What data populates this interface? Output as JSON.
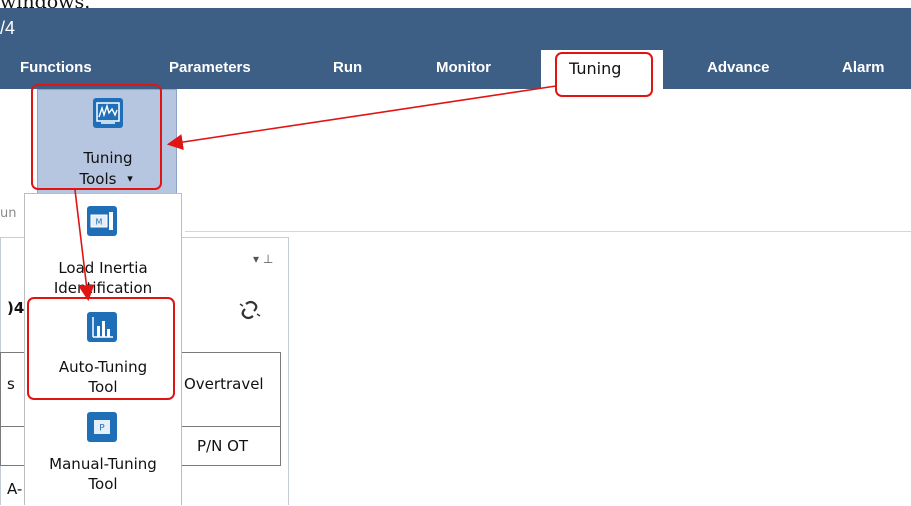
{
  "caption": "windows.",
  "window": {
    "version": "/4"
  },
  "menu": {
    "tabs": [
      {
        "label": "Functions"
      },
      {
        "label": "Parameters"
      },
      {
        "label": "Run"
      },
      {
        "label": "Monitor"
      },
      {
        "label": "Tuning"
      },
      {
        "label": "Advance"
      },
      {
        "label": "Alarm"
      }
    ],
    "active_tab": "Tuning"
  },
  "ribbon": {
    "tuning_tools": {
      "line1": "Tuning",
      "line2": "Tools",
      "dropdown_arrow": "▾",
      "icon": "tuning-chart-icon"
    },
    "group_label_fragment": "un"
  },
  "dropdown": {
    "items": [
      {
        "line1": "Load Inertia",
        "line2": "Identification",
        "icon": "motor-m-icon",
        "icon_text": "M"
      },
      {
        "line1": "Auto-Tuning",
        "line2": "Tool",
        "icon": "bar-chart-icon"
      },
      {
        "line1": "Manual-Tuning",
        "line2": "Tool",
        "icon": "p-icon",
        "icon_text": "P"
      }
    ]
  },
  "panel": {
    "pin_glyph": "▾ ⊥",
    "title_fragment": ")4",
    "link_icon": "unlink-icon",
    "cells": {
      "left_row1": "s",
      "overtravel": "Overtravel",
      "pn_ot": "P/N OT",
      "bottom_fragment": "A-"
    }
  },
  "colors": {
    "titlebar": "#3e5f85",
    "highlight": "#e11414",
    "ribbon_button": "#b6c5e0",
    "icon_blue": "#1f6fb8"
  }
}
